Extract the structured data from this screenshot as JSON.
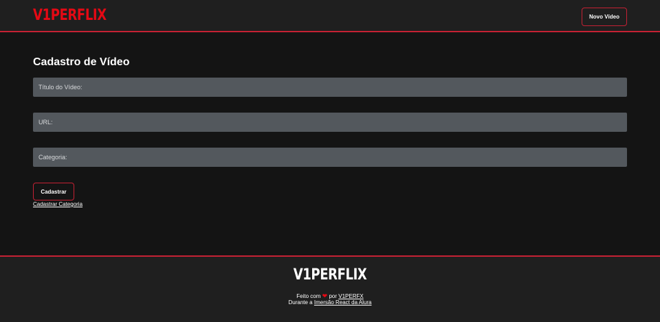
{
  "header": {
    "logo": "V1PERFLIX",
    "new_video_button": "Novo Vídeo"
  },
  "form": {
    "title": "Cadastro de Vídeo",
    "fields": [
      {
        "label": "Título do Vídeo:"
      },
      {
        "label": "URL:"
      },
      {
        "label": "Categoria:"
      }
    ],
    "submit_button": "Cadastrar",
    "category_link": "Cadastrar Categoria"
  },
  "footer": {
    "logo": "V1PERFLIX",
    "made_with": "Feito com",
    "heart_icon": "heart-icon",
    "by": "por",
    "author": "V1PERFX",
    "during": "Durante a",
    "event": "Imersão React da Alura"
  },
  "colors": {
    "accent": "#c62134",
    "logo": "#e50914",
    "background": "#141414",
    "bars": "#1f1f1f",
    "field": "#53585d"
  }
}
